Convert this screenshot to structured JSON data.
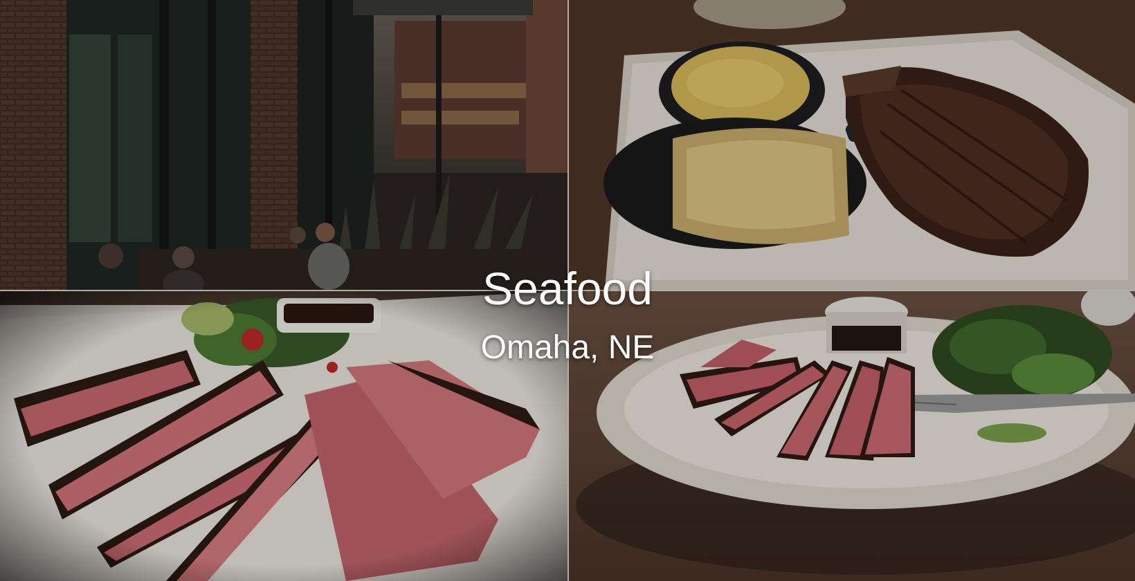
{
  "hero": {
    "title": "Seafood",
    "subtitle": "Omaha, NE"
  },
  "photos": [
    {
      "slot": "top-left",
      "subject": "restaurant-exterior-patio"
    },
    {
      "slot": "top-right",
      "subject": "steak-plate-with-sides"
    },
    {
      "slot": "bottom-left",
      "subject": "seared-tuna-plate"
    },
    {
      "slot": "bottom-right",
      "subject": "seared-tuna-with-salad"
    }
  ],
  "colors": {
    "text": "#ffffff",
    "divider": "#d9d4cf",
    "brick": "#4a3028",
    "wood": "#5a4030",
    "plate": "#e9e4dc",
    "tuna": "#c86a72"
  }
}
